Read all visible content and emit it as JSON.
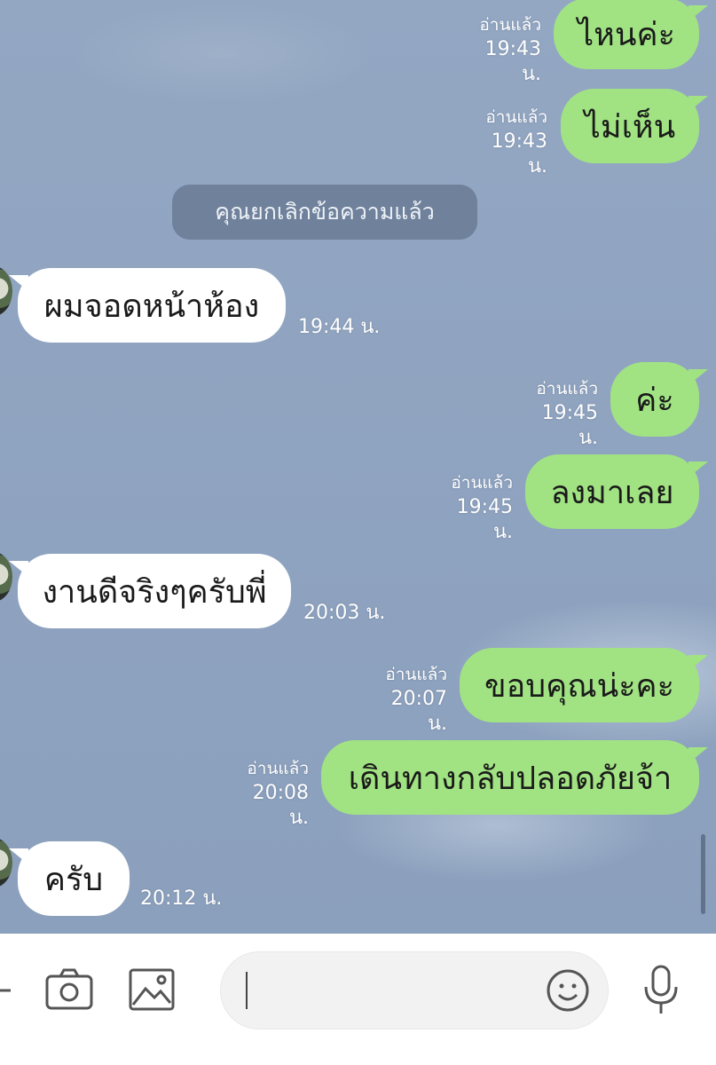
{
  "messages": [
    {
      "side": "out",
      "text": "ไหนค่ะ",
      "read": "อ่านแล้ว",
      "time": "19:43 น."
    },
    {
      "side": "out",
      "text": "ไม่เห็น",
      "read": "อ่านแล้ว",
      "time": "19:43 น."
    },
    {
      "side": "system",
      "text": "คุณยกเลิกข้อความแล้ว"
    },
    {
      "side": "in",
      "text": "ผมจอดหน้าห้อง",
      "time": "19:44 น."
    },
    {
      "side": "out",
      "text": "ค่ะ",
      "read": "อ่านแล้ว",
      "time": "19:45 น."
    },
    {
      "side": "out",
      "text": "ลงมาเลย",
      "read": "อ่านแล้ว",
      "time": "19:45 น."
    },
    {
      "side": "in",
      "text": "งานดีจริงๆครับพี่",
      "time": "20:03 น."
    },
    {
      "side": "out",
      "text": "ขอบคุณน่ะคะ",
      "read": "อ่านแล้ว",
      "time": "20:07 น."
    },
    {
      "side": "out",
      "text": "เดินทางกลับปลอดภัยจ้า",
      "read": "อ่านแล้ว",
      "time": "20:08 น."
    },
    {
      "side": "in",
      "text": "ครับ",
      "time": "20:12 น."
    }
  ],
  "composer": {
    "icons": [
      "more-icon",
      "camera-icon",
      "image-icon",
      "emoji-icon",
      "microphone-icon"
    ]
  },
  "colors": {
    "outgoing_bubble": "#a1e383",
    "incoming_bubble": "#ffffff",
    "chat_background": "#8ea3c0"
  }
}
